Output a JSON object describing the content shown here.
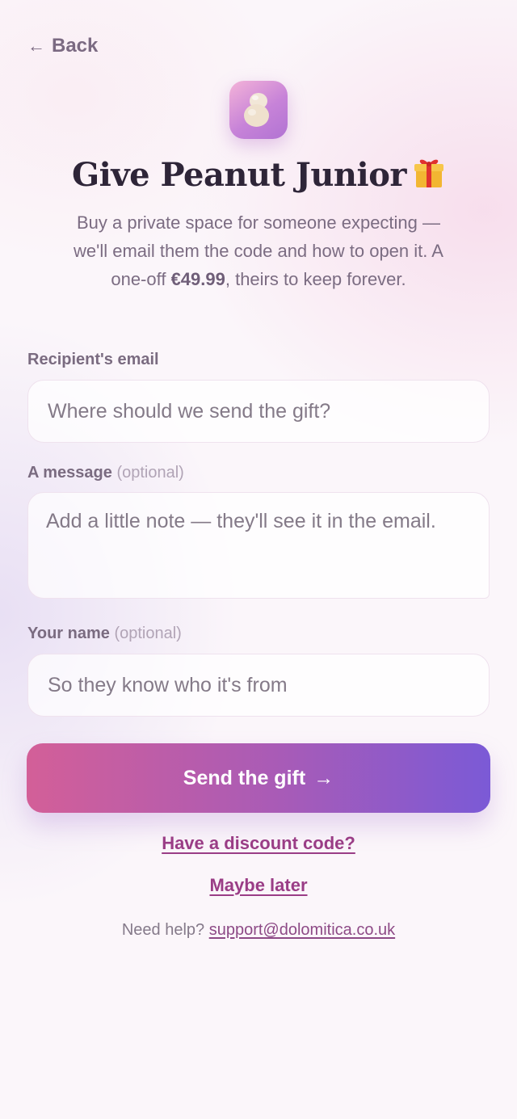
{
  "nav": {
    "back_label": "Back",
    "back_icon": "arrow-left-icon"
  },
  "header": {
    "logo_icon": "peanut-icon",
    "title": "Give Peanut Junior",
    "title_icon": "wrapped-gift-icon",
    "subtitle_part1": "Buy a private space for someone expecting — we'll email them the code and how to open it. A one-off ",
    "subtitle_price": "€49.99",
    "subtitle_part2": ", theirs to keep forever."
  },
  "form": {
    "recipient": {
      "label": "Recipient's email",
      "placeholder": "Where should we send the gift?",
      "value": ""
    },
    "message": {
      "label": "A message",
      "optional": "(optional)",
      "placeholder": "Add a little note — they'll see it in the email.",
      "value": ""
    },
    "sender": {
      "label": "Your name",
      "optional": "(optional)",
      "placeholder": "So they know who it's from",
      "value": ""
    }
  },
  "actions": {
    "send_label": "Send the gift",
    "send_arrow": "→",
    "discount_label": "Have a discount code?",
    "later_label": "Maybe later"
  },
  "help": {
    "prefix": "Need help?",
    "email": "support@dolomitica.co.uk"
  },
  "colors": {
    "accent_start": "#d35f98",
    "accent_end": "#7b5ad6",
    "link": "#9a3d86"
  }
}
